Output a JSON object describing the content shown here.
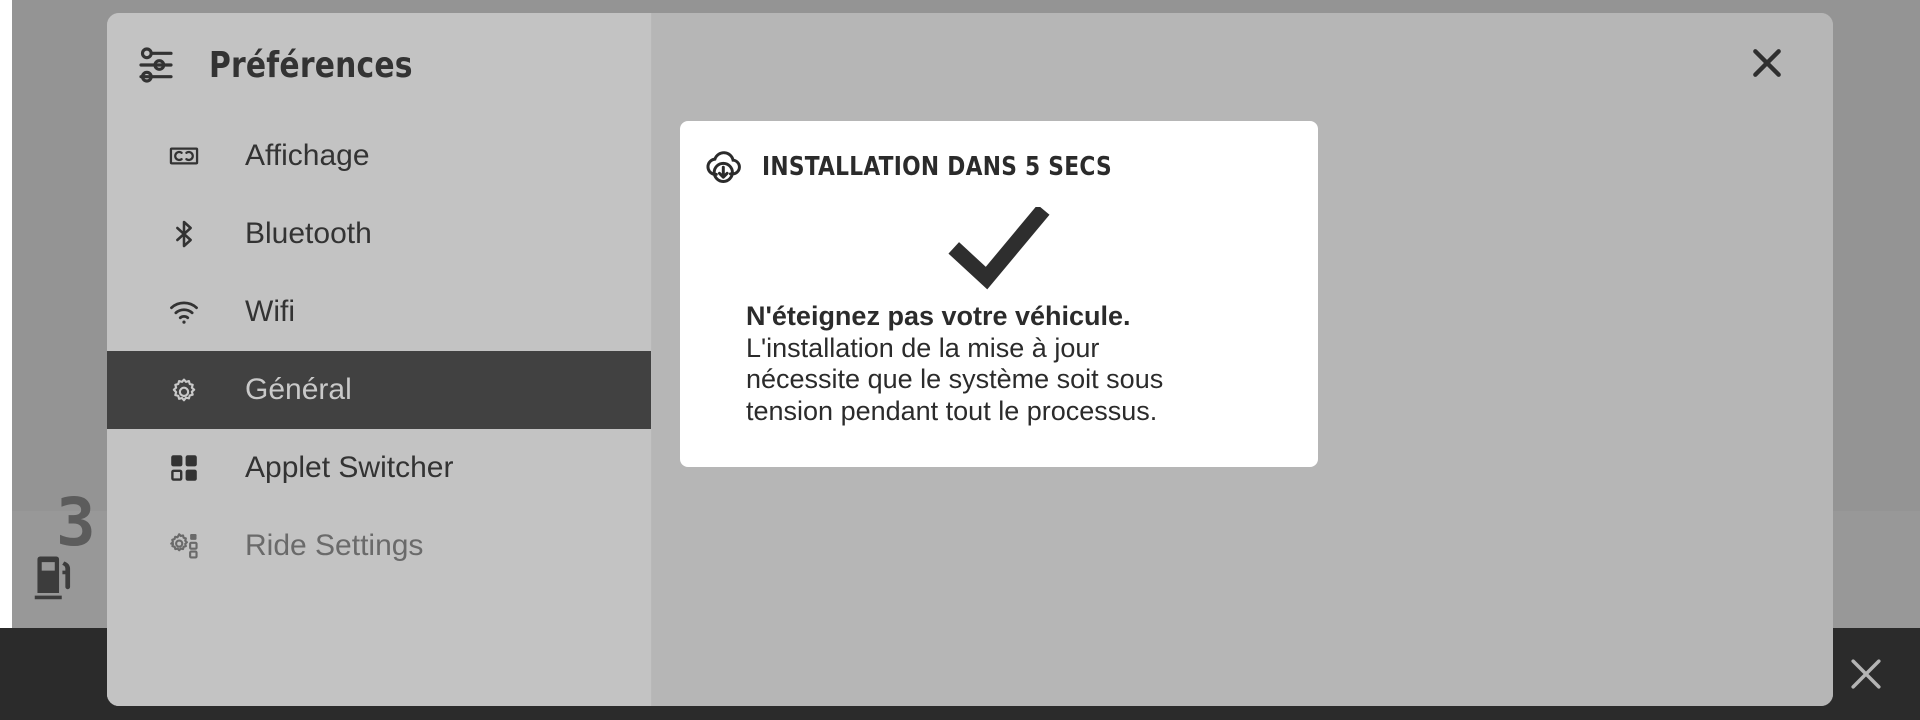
{
  "background": {
    "fuel_icon": "fuel-pump-icon",
    "gear_digit": "3",
    "bottom_close_icon": "close-icon"
  },
  "dialog": {
    "header": {
      "icon": "sliders-icon",
      "title": "Préférences"
    },
    "close_icon": "close-icon",
    "nav": [
      {
        "label": "Affichage",
        "icon": "display-icon",
        "state": "normal"
      },
      {
        "label": "Bluetooth",
        "icon": "bluetooth-icon",
        "state": "normal"
      },
      {
        "label": "Wifi",
        "icon": "wifi-icon",
        "state": "normal"
      },
      {
        "label": "Général",
        "icon": "gear-icon",
        "state": "selected"
      },
      {
        "label": "Applet Switcher",
        "icon": "grid-squares-icon",
        "state": "normal"
      },
      {
        "label": "Ride Settings",
        "icon": "gear-settings-icon",
        "state": "dimmed"
      }
    ],
    "card": {
      "icon": "cloud-download-icon",
      "title": "INSTALLATION DANS 5 SECS",
      "status_icon": "checkmark-icon",
      "body_strong": "N'éteignez pas votre véhicule.",
      "body_text": "L'installation de la mise à jour nécessite que le système soit sous tension pendant tout le processus."
    }
  },
  "colors": {
    "dialog_bg": "#b6b6b6",
    "sidebar_bg": "#c3c3c3",
    "selected_row": "#414141",
    "card_bg": "#ffffff",
    "text_dark": "#2b2b2b",
    "bottom_bar": "#2b2b2b",
    "backdrop": "#989898"
  }
}
